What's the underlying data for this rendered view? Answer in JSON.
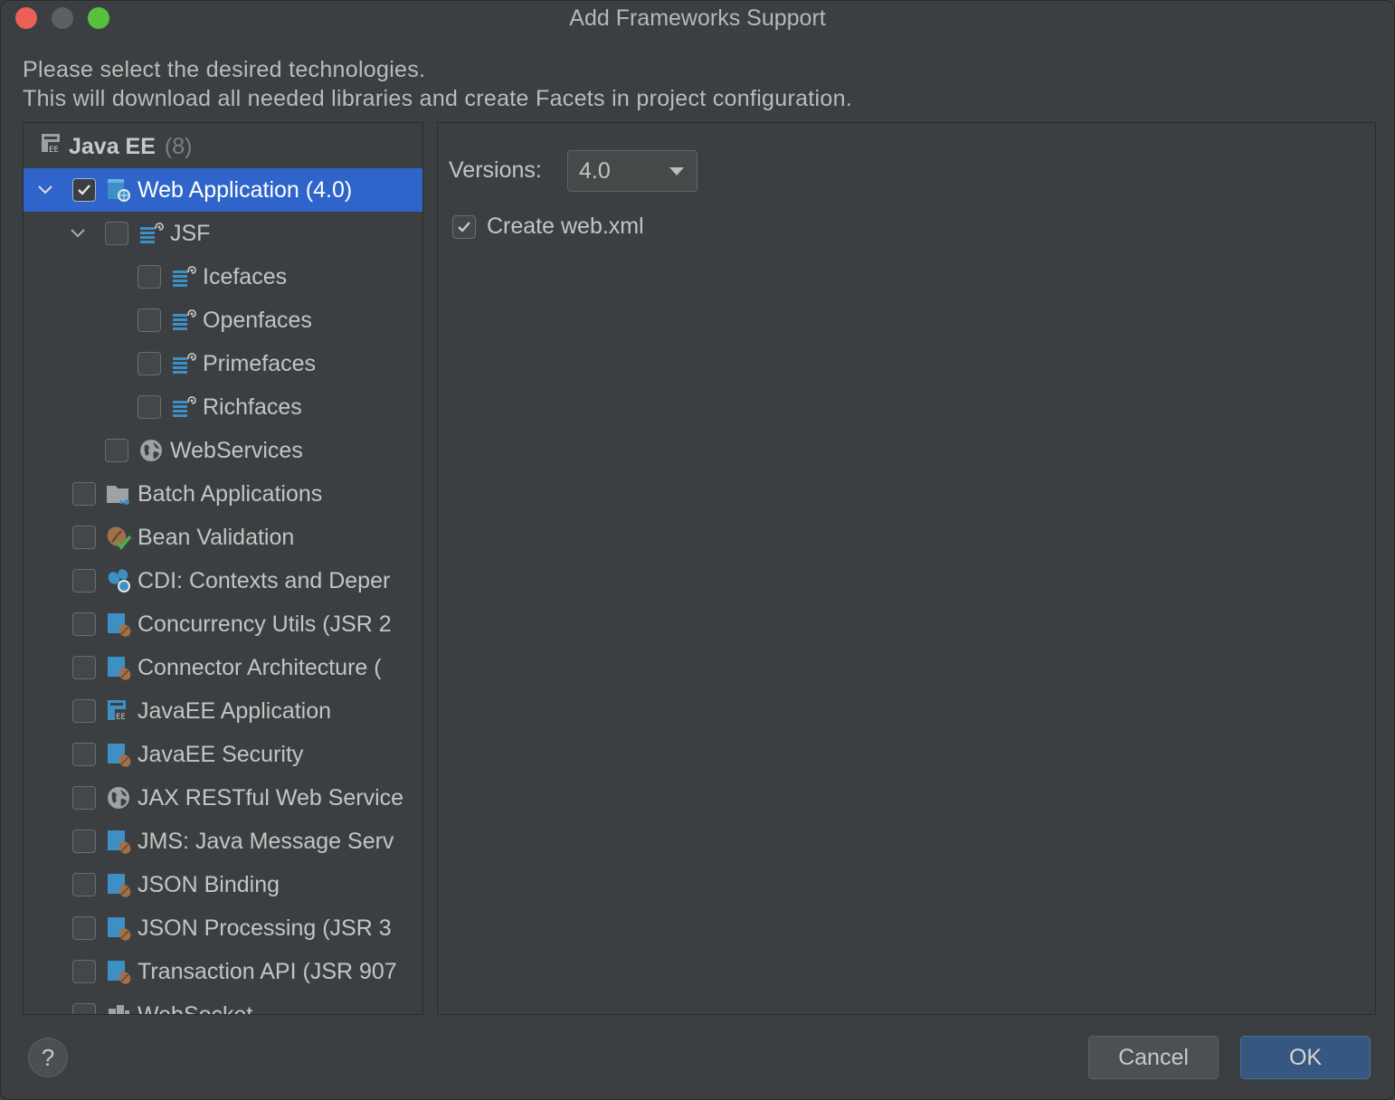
{
  "window": {
    "title": "Add Frameworks Support"
  },
  "description": {
    "line1": "Please select the desired technologies.",
    "line2": "This will download all needed libraries and create Facets in project configuration."
  },
  "tree": {
    "group": {
      "name": "Java EE",
      "count": "(8)"
    },
    "items": [
      {
        "label": "Web Application (4.0)",
        "checked": true,
        "expanded": true,
        "icon": "web-app-icon",
        "level": 0
      },
      {
        "label": "JSF",
        "checked": false,
        "expanded": true,
        "icon": "jsf-icon",
        "level": 1
      },
      {
        "label": "Icefaces",
        "checked": false,
        "icon": "jsf-icon",
        "level": 2
      },
      {
        "label": "Openfaces",
        "checked": false,
        "icon": "jsf-icon",
        "level": 2
      },
      {
        "label": "Primefaces",
        "checked": false,
        "icon": "jsf-icon",
        "level": 2
      },
      {
        "label": "Richfaces",
        "checked": false,
        "icon": "jsf-icon",
        "level": 2
      },
      {
        "label": "WebServices",
        "checked": false,
        "icon": "globe-icon",
        "level": 1
      },
      {
        "label": "Batch Applications",
        "checked": false,
        "icon": "batch-folder-icon",
        "level": 0
      },
      {
        "label": "Bean Validation",
        "checked": false,
        "icon": "bean-validation-icon",
        "level": 0
      },
      {
        "label": "CDI: Contexts and Deper",
        "checked": false,
        "icon": "cdi-icon",
        "level": 0
      },
      {
        "label": "Concurrency Utils (JSR 2",
        "checked": false,
        "icon": "javaee-module-icon",
        "level": 0
      },
      {
        "label": "Connector Architecture (",
        "checked": false,
        "icon": "javaee-module-icon",
        "level": 0
      },
      {
        "label": "JavaEE Application",
        "checked": false,
        "icon": "javaee-app-icon",
        "level": 0
      },
      {
        "label": "JavaEE Security",
        "checked": false,
        "icon": "javaee-module-icon",
        "level": 0
      },
      {
        "label": "JAX RESTful Web Service",
        "checked": false,
        "icon": "globe-icon",
        "level": 0
      },
      {
        "label": "JMS: Java Message Serv",
        "checked": false,
        "icon": "javaee-module-icon",
        "level": 0
      },
      {
        "label": "JSON Binding",
        "checked": false,
        "icon": "javaee-module-icon",
        "level": 0
      },
      {
        "label": "JSON Processing (JSR 3",
        "checked": false,
        "icon": "javaee-module-icon",
        "level": 0
      },
      {
        "label": "Transaction API (JSR 907",
        "checked": false,
        "icon": "javaee-module-icon",
        "level": 0
      },
      {
        "label": "WebSocket",
        "checked": false,
        "icon": "websocket-icon",
        "level": 0
      }
    ]
  },
  "details": {
    "versions_label": "Versions:",
    "version_value": "4.0",
    "create_webxml_label": "Create web.xml",
    "create_webxml_checked": true
  },
  "footer": {
    "help": "?",
    "cancel": "Cancel",
    "ok": "OK"
  },
  "colors": {
    "background": "#3c3f41",
    "selection": "#2f65ca",
    "ok_button": "#365880",
    "icon_blue": "#3d8fc4",
    "icon_brown": "#a0704a"
  }
}
